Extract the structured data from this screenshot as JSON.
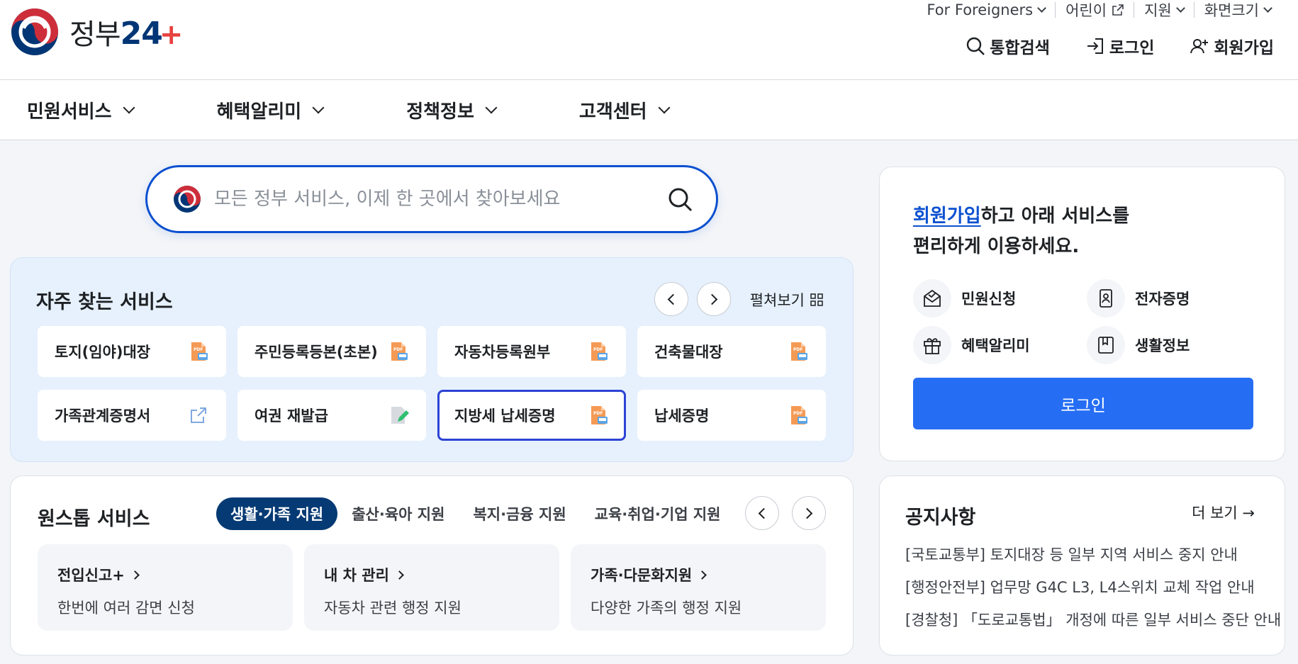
{
  "brand": {
    "name": "정부",
    "num": "24",
    "plus": "+"
  },
  "util_links": [
    {
      "label": "For Foreigners"
    },
    {
      "label": "어린이"
    },
    {
      "label": "지원"
    },
    {
      "label": "화면크기"
    }
  ],
  "main_links": {
    "search": "통합검색",
    "login": "로그인",
    "signup": "회원가입"
  },
  "nav": [
    "민원서비스",
    "혜택알리미",
    "정책정보",
    "고객센터"
  ],
  "search": {
    "placeholder": "모든 정부 서비스, 이제 한 곳에서 찾아보세요"
  },
  "frequent": {
    "title": "자주 찾는 서비스",
    "expand": "펼쳐보기",
    "items": [
      {
        "label": "토지(임야)대장",
        "icon": "pdf-icon"
      },
      {
        "label": "주민등록등본(초본)",
        "icon": "pdf-icon"
      },
      {
        "label": "자동차등록원부",
        "icon": "pdf-icon"
      },
      {
        "label": "건축물대장",
        "icon": "pdf-icon"
      },
      {
        "label": "가족관계증명서",
        "icon": "external-link-icon"
      },
      {
        "label": "여권 재발급",
        "icon": "edit-document-icon"
      },
      {
        "label": "지방세 납세증명",
        "icon": "pdf-icon"
      },
      {
        "label": "납세증명",
        "icon": "pdf-icon"
      }
    ]
  },
  "onestop": {
    "title": "원스톱 서비스",
    "tabs": [
      "생활·가족 지원",
      "출산·육아 지원",
      "복지·금융 지원",
      "교육·취업·기업 지원"
    ],
    "active_tab": "생활·가족 지원",
    "cards": [
      {
        "title": "전입신고+",
        "desc": "한번에 여러 감면 신청"
      },
      {
        "title": "내 차 관리",
        "desc": "자동차 관련 행정 지원"
      },
      {
        "title": "가족·다문화지원",
        "desc": "다양한 가족의 행정 지원"
      }
    ]
  },
  "login_box": {
    "msg_link": "회원가입",
    "msg_rest": "하고 아래 서비스를",
    "msg_line2": "편리하게 이용하세요.",
    "features": [
      "민원신청",
      "전자증명",
      "혜택알리미",
      "생활정보"
    ],
    "button": "로그인"
  },
  "notice": {
    "title": "공지사항",
    "more": "더 보기 →",
    "items": [
      "[국토교통부] 토지대장 등 일부 지역 서비스 중지 안내",
      "[행정안전부] 업무망 G4C L3, L4스위치 교체 작업 안내",
      "[경찰청] 「도로교통법」 개정에 따른 일부 서비스 중단 안내"
    ]
  },
  "colors": {
    "primary": "#256ef4",
    "navy": "#063a74",
    "focus": "#2c43d6",
    "panel_blue": "#e6f1fd"
  }
}
